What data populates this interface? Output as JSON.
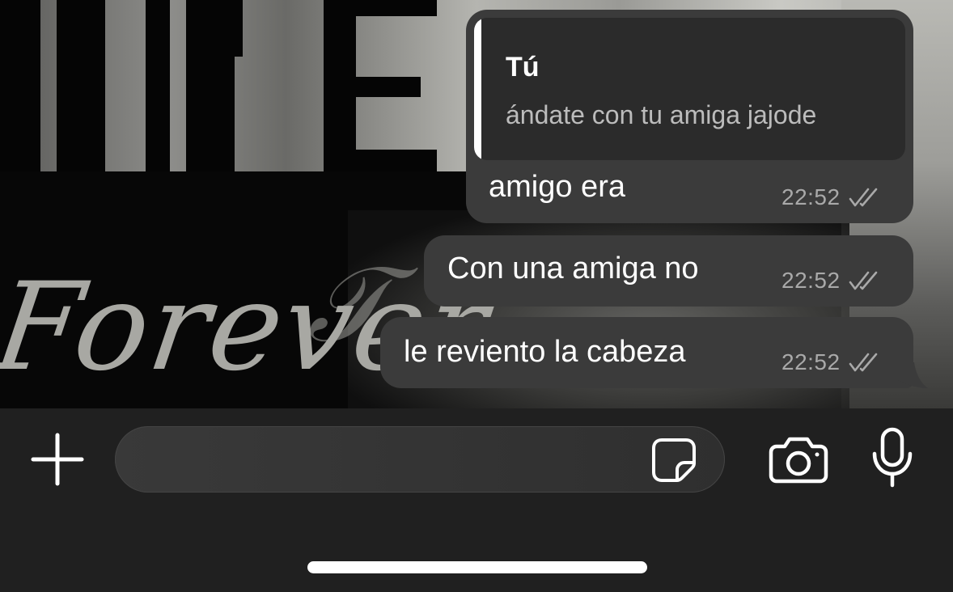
{
  "wallpaper": {
    "script_text": "Forever"
  },
  "messages": [
    {
      "quote": {
        "author": "Tú",
        "text": "ándate con tu amiga jajode"
      },
      "text": "amigo era",
      "time": "22:52",
      "status_icon": "double-check-icon"
    },
    {
      "text": "Con una amiga no",
      "time": "22:52",
      "status_icon": "double-check-icon"
    },
    {
      "text": "le reviento la cabeza",
      "time": "22:52",
      "status_icon": "double-check-icon"
    }
  ],
  "composer": {
    "input_value": "",
    "icons": [
      "plus-icon",
      "sticker-icon",
      "camera-icon",
      "microphone-icon"
    ]
  },
  "colors": {
    "bubble": "#3b3b3b",
    "quote_background": "#2b2b2b",
    "composer_background": "#202020",
    "timestamp": "#a9a9a9"
  }
}
